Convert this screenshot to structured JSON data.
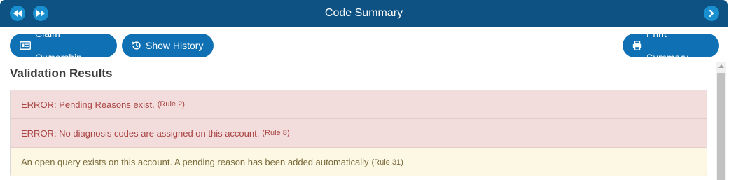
{
  "header": {
    "title": "Code Summary",
    "nav_left_icons": [
      "rewind-icon",
      "fast-forward-icon"
    ],
    "nav_right_icon": "chevron-right-icon"
  },
  "toolbar": {
    "claim_ownership_label": "Claim Ownership",
    "claim_ownership_icon": "id-card-icon",
    "show_history_label": "Show History",
    "show_history_icon": "history-icon",
    "print_summary_label": "Print Summary",
    "print_summary_icon": "printer-icon"
  },
  "validation": {
    "title": "Validation Results",
    "items": [
      {
        "type": "error",
        "message": "ERROR: Pending Reasons exist.",
        "rule": "(Rule 2)"
      },
      {
        "type": "error",
        "message": "ERROR: No diagnosis codes are assigned on this account.",
        "rule": "(Rule 8)"
      },
      {
        "type": "warning",
        "message": "An open query exists on this account. A pending reason has been added automatically",
        "rule": "(Rule 31)"
      }
    ]
  },
  "colors": {
    "header_bg": "#0d5283",
    "button_bg": "#0f71b3",
    "nav_button_bg": "#1a8fd0",
    "error_bg": "#f2dcdc",
    "error_text": "#a94442",
    "warning_bg": "#fcf8e3",
    "warning_text": "#7a6a3b"
  }
}
